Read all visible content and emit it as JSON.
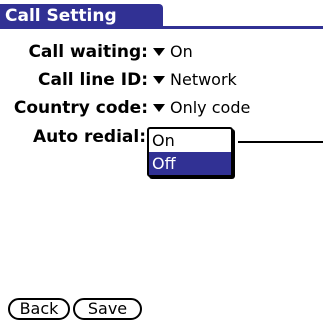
{
  "title": "Call Setting",
  "settings": [
    {
      "label": "Call waiting:",
      "value": "On"
    },
    {
      "label": "Call line ID:",
      "value": "Network"
    },
    {
      "label": "Country code:",
      "value": "Only code"
    },
    {
      "label": "Auto redial:"
    }
  ],
  "popup": {
    "options": [
      "On",
      "Off"
    ],
    "selected": "Off"
  },
  "buttons": {
    "back": "Back",
    "save": "Save"
  },
  "colors": {
    "accent": "#313194",
    "background": "#ffffff"
  }
}
